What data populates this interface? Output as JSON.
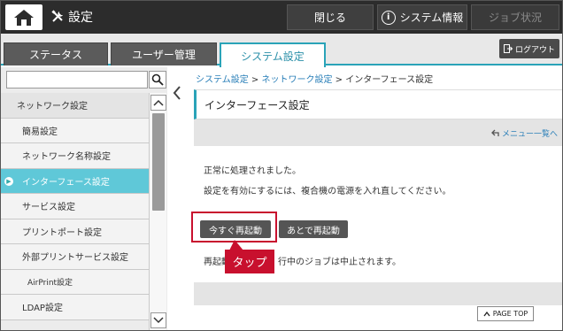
{
  "topbar": {
    "title": "設定",
    "close_label": "閉じる",
    "system_info_label": "システム情報",
    "info_glyph": "i",
    "job_status_label": "ジョブ状況"
  },
  "tabs": [
    {
      "label": "ステータス"
    },
    {
      "label": "ユーザー管理"
    },
    {
      "label": "システム設定"
    }
  ],
  "logout_label": "ログアウト",
  "search": {
    "value": ""
  },
  "sidebar": {
    "items": [
      {
        "label": "ネットワーク設定"
      },
      {
        "label": "簡易設定"
      },
      {
        "label": "ネットワーク名称設定"
      },
      {
        "label": "インターフェース設定"
      },
      {
        "label": "サービス設定"
      },
      {
        "label": "プリントポート設定"
      },
      {
        "label": "外部プリントサービス設定"
      },
      {
        "label": "AirPrint設定"
      },
      {
        "label": "LDAP設定"
      }
    ]
  },
  "breadcrumb": {
    "item1": "システム設定",
    "sep": " > ",
    "item2": "ネットワーク設定",
    "current": "インターフェース設定"
  },
  "page_title": "インターフェース設定",
  "menu_back_label": "メニュー一覧へ",
  "messages": {
    "line1": "正常に処理されました。",
    "line2": "設定を有効にするには、複合機の電源を入れ直してください。",
    "line3_start": "再起動",
    "line3_end": "行中のジョブは中止されます。"
  },
  "buttons": {
    "restart_now": "今すぐ再起動",
    "restart_later": "あとで再起動"
  },
  "callout_label": "タップ",
  "page_top_label": "PAGE TOP",
  "colors": {
    "accent": "#2aa3b8",
    "active_item": "#5fc8d8",
    "highlight": "#c8102e",
    "topbar": "#2c2c2c"
  }
}
